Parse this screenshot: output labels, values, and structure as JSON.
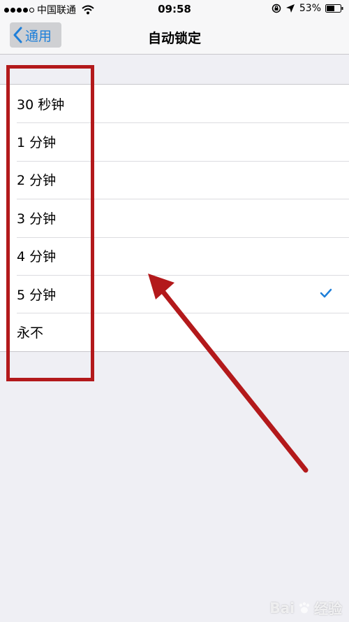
{
  "status_bar": {
    "carrier": "中国联通",
    "time": "09:58",
    "battery": "53%"
  },
  "nav": {
    "back_label": "通用",
    "title": "自动锁定"
  },
  "options": [
    {
      "label": "30 秒钟",
      "selected": false
    },
    {
      "label": "1 分钟",
      "selected": false
    },
    {
      "label": "2 分钟",
      "selected": false
    },
    {
      "label": "3 分钟",
      "selected": false
    },
    {
      "label": "4 分钟",
      "selected": false
    },
    {
      "label": "5 分钟",
      "selected": true
    },
    {
      "label": "永不",
      "selected": false
    }
  ],
  "watermark": {
    "logo_text": "Bai",
    "suffix": "经验"
  },
  "colors": {
    "accent": "#1e7fd9",
    "annotation": "#b3191b"
  }
}
